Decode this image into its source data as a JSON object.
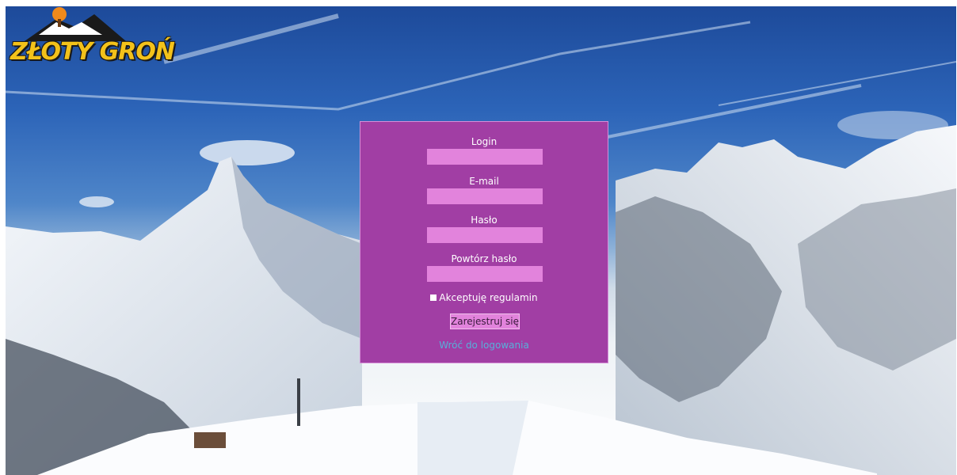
{
  "logo": {
    "text": "ZŁOTY GROŃ"
  },
  "form": {
    "login_label": "Login",
    "login_value": "",
    "email_label": "E-mail",
    "email_value": "",
    "password_label": "Hasło",
    "password_value": "",
    "repeat_password_label": "Powtórz hasło",
    "repeat_password_value": "",
    "terms_label": "Akceptuję regulamin",
    "register_label": "Zarejestruj się",
    "back_link": "Wróć do logowania"
  },
  "colors": {
    "panel": "#a13ea4",
    "input": "#e283dc",
    "link": "#58b0da",
    "logo_text": "#f3c21a"
  }
}
